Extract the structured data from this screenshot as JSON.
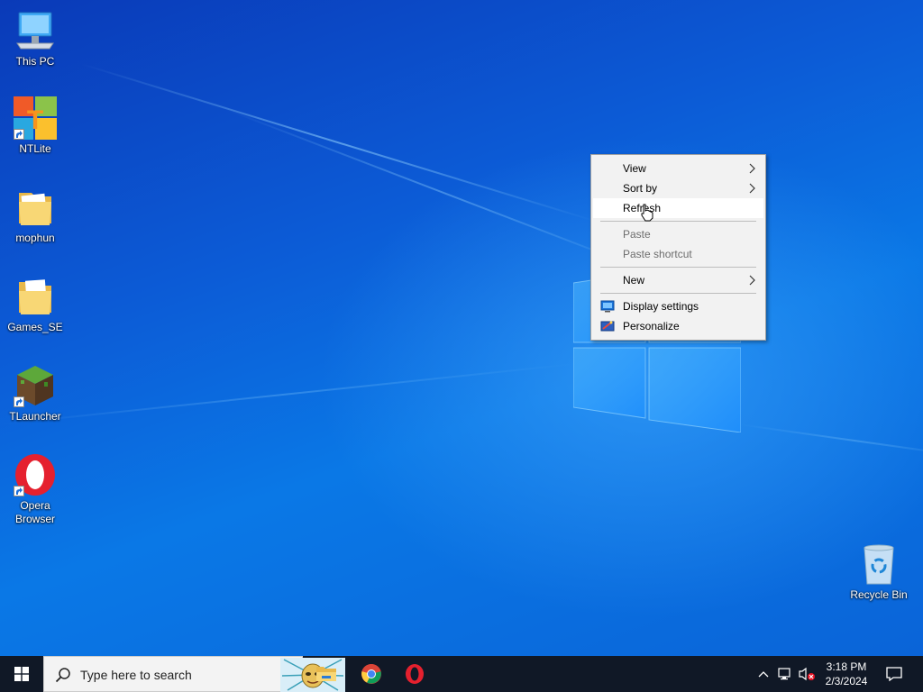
{
  "desktop_icons": [
    {
      "label": "This PC",
      "icon": "computer-icon"
    },
    {
      "label": "NTLite",
      "icon": "ntlite-icon",
      "shortcut": true
    },
    {
      "label": "mophun",
      "icon": "folder-icon"
    },
    {
      "label": "Games_SE",
      "icon": "folder-icon"
    },
    {
      "label": "TLauncher",
      "icon": "tlauncher-icon",
      "shortcut": true
    },
    {
      "label": "Opera Browser",
      "icon": "opera-icon",
      "shortcut": true
    },
    {
      "label": "Recycle Bin",
      "icon": "recycle-bin-icon"
    }
  ],
  "context_menu": {
    "items": [
      {
        "label": "View",
        "submenu": true
      },
      {
        "label": "Sort by",
        "submenu": true
      },
      {
        "label": "Refresh",
        "highlighted": true
      },
      {
        "label": "Paste",
        "disabled": true
      },
      {
        "label": "Paste shortcut",
        "disabled": true
      },
      {
        "label": "New",
        "submenu": true
      },
      {
        "label": "Display settings",
        "icon": "display-icon"
      },
      {
        "label": "Personalize",
        "icon": "personalize-icon"
      }
    ]
  },
  "taskbar": {
    "search_placeholder": "Type here to search",
    "pinned_apps": [
      "file-explorer-icon",
      "chrome-icon",
      "opera-icon"
    ],
    "clock": {
      "time": "3:18 PM",
      "date": "2/3/2024"
    }
  },
  "colors": {
    "taskbar": "#101826",
    "menu_bg": "#f2f2f2",
    "accent": "#0a78e6"
  }
}
